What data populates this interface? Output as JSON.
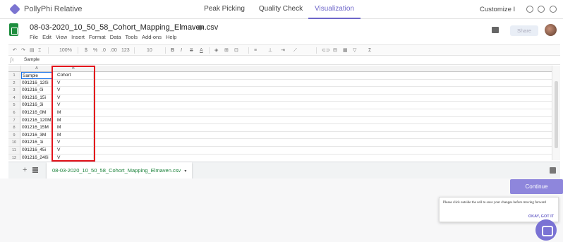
{
  "app": {
    "brand": "PollyPhi Relative"
  },
  "nav": {
    "tabs": [
      {
        "label": "Peak Picking"
      },
      {
        "label": "Quality Check"
      },
      {
        "label": "Visualization"
      }
    ],
    "customize": "Customize I",
    "accent": "#6e66c9"
  },
  "sheet": {
    "title": "08-03-2020_10_50_58_Cohort_Mapping_Elmaven.csv",
    "menus": [
      "File",
      "Edit",
      "View",
      "Insert",
      "Format",
      "Data",
      "Tools",
      "Add-ons",
      "Help"
    ],
    "share_label": "Share",
    "toolbar": {
      "zoom": "100%",
      "currency": "$",
      "percent": "%",
      "dec_less": ".0",
      "dec_more": ".00",
      "format_123": "123",
      "font_size": "10",
      "bold": "B",
      "italic": "I",
      "strike": "S",
      "text_color": "A",
      "sum": "Σ"
    },
    "formula_label": "fx",
    "formula_value": "Sample",
    "columns": [
      "A",
      "B"
    ],
    "rows": [
      {
        "num": "1",
        "a": "Sample",
        "b": "Cohort"
      },
      {
        "num": "2",
        "a": "091216_120i",
        "b": "V"
      },
      {
        "num": "3",
        "a": "091216_0i",
        "b": "V"
      },
      {
        "num": "4",
        "a": "091216_15i",
        "b": "V"
      },
      {
        "num": "5",
        "a": "091216_3i",
        "b": "V"
      },
      {
        "num": "6",
        "a": "091216_0M",
        "b": "M"
      },
      {
        "num": "7",
        "a": "091216_120M",
        "b": "M"
      },
      {
        "num": "8",
        "a": "091216_15M",
        "b": "M"
      },
      {
        "num": "9",
        "a": "091216_3M",
        "b": "M"
      },
      {
        "num": "10",
        "a": "091216_1i",
        "b": "V"
      },
      {
        "num": "11",
        "a": "091216_45i",
        "b": "V"
      },
      {
        "num": "12",
        "a": "091216_240i",
        "b": "V"
      }
    ],
    "tab_name": "08-03-2020_10_50_58_Cohort_Mapping_Elmaven.csv",
    "tab_color": "#188038"
  },
  "actions": {
    "continue_label": "Continue",
    "tooltip_text": "Please click outside the cell to save your changes before moving forward",
    "tooltip_button": "OKAY, GOT IT"
  },
  "colors": {
    "highlight": "#e3131b",
    "continue_bg": "#8e86dc"
  }
}
